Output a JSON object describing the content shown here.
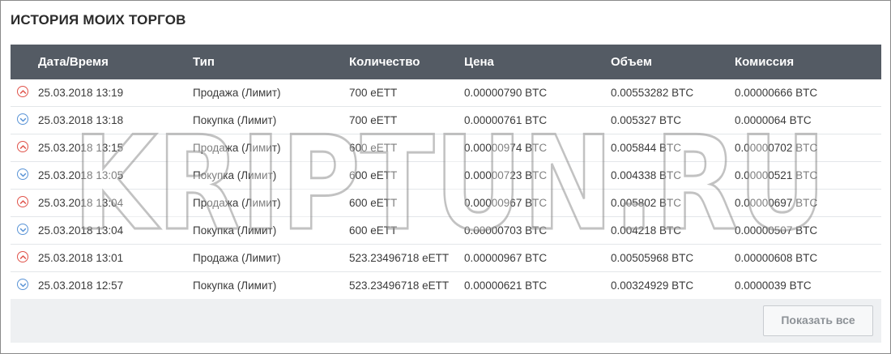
{
  "panel": {
    "title": "ИСТОРИЯ МОИХ ТОРГОВ"
  },
  "table": {
    "columns": [
      "Дата/Время",
      "Тип",
      "Количество",
      "Цена",
      "Объем",
      "Комиссия"
    ],
    "rows": [
      {
        "side": "sell",
        "icon": "arrow-up-circle-icon",
        "cells": [
          "25.03.2018 13:19",
          "Продажа (Лимит)",
          "700 eETT",
          "0.00000790 BTC",
          "0.00553282 BTC",
          "0.00000666 BTC"
        ]
      },
      {
        "side": "buy",
        "icon": "arrow-down-circle-icon",
        "cells": [
          "25.03.2018 13:18",
          "Покупка (Лимит)",
          "700 eETT",
          "0.00000761 BTC",
          "0.005327 BTC",
          "0.0000064 BTC"
        ]
      },
      {
        "side": "sell",
        "icon": "arrow-up-circle-icon",
        "cells": [
          "25.03.2018 13:15",
          "Продажа (Лимит)",
          "600 eETT",
          "0.00000974 BTC",
          "0.005844 BTC",
          "0.00000702 BTC"
        ]
      },
      {
        "side": "buy",
        "icon": "arrow-down-circle-icon",
        "cells": [
          "25.03.2018 13:05",
          "Покупка (Лимит)",
          "600 eETT",
          "0.00000723 BTC",
          "0.004338 BTC",
          "0.00000521 BTC"
        ]
      },
      {
        "side": "sell",
        "icon": "arrow-up-circle-icon",
        "cells": [
          "25.03.2018 13:04",
          "Продажа (Лимит)",
          "600 eETT",
          "0.00000967 BTC",
          "0.005802 BTC",
          "0.00000697 BTC"
        ]
      },
      {
        "side": "buy",
        "icon": "arrow-down-circle-icon",
        "cells": [
          "25.03.2018 13:04",
          "Покупка (Лимит)",
          "600 eETT",
          "0.00000703 BTC",
          "0.004218 BTC",
          "0.00000507 BTC"
        ]
      },
      {
        "side": "sell",
        "icon": "arrow-up-circle-icon",
        "cells": [
          "25.03.2018 13:01",
          "Продажа (Лимит)",
          "523.23496718 eETT",
          "0.00000967 BTC",
          "0.00505968 BTC",
          "0.00000608 BTC"
        ]
      },
      {
        "side": "buy",
        "icon": "arrow-down-circle-icon",
        "cells": [
          "25.03.2018 12:57",
          "Покупка (Лимит)",
          "523.23496718 eETT",
          "0.00000621 BTC",
          "0.00324929 BTC",
          "0.0000039 BTC"
        ]
      }
    ]
  },
  "footer": {
    "show_all_label": "Показать все"
  },
  "watermark": {
    "text": "KRIPTUN.RU"
  },
  "colors": {
    "header_bg": "#545b64",
    "sell": "#e0534a",
    "buy": "#5a94d6",
    "footer_bg": "#eef0f2"
  }
}
